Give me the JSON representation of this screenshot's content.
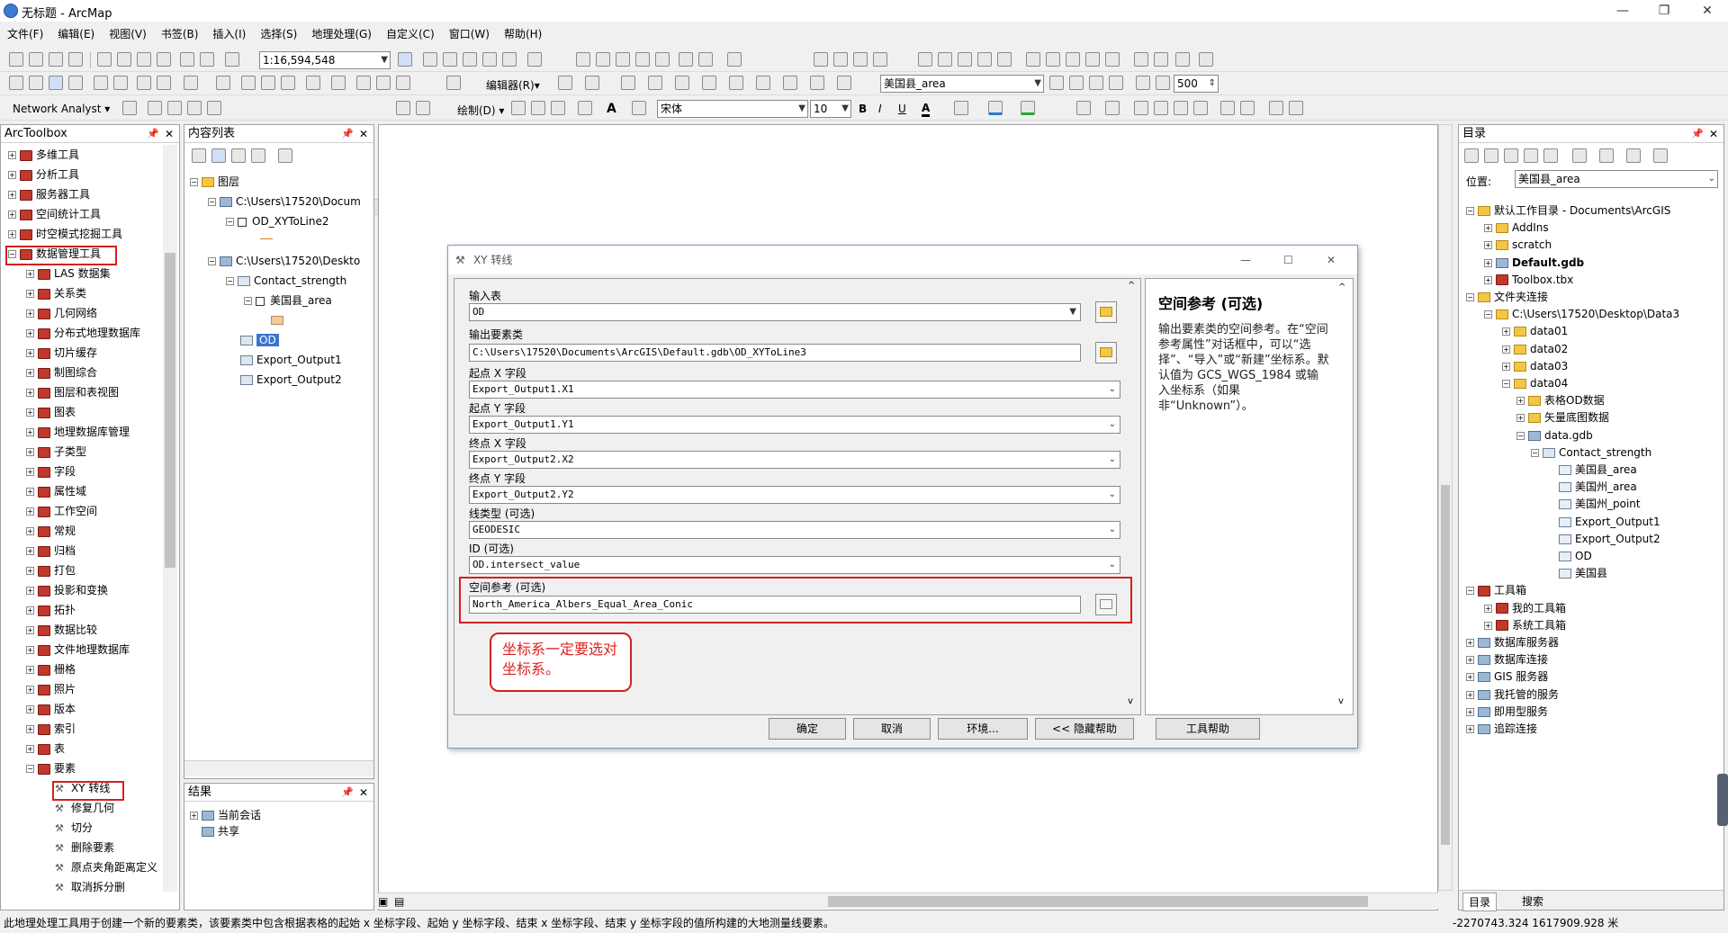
{
  "window": {
    "title": "无标题 - ArcMap",
    "minimize": "—",
    "maximize": "❐",
    "close": "✕"
  },
  "menu": [
    "文件(F)",
    "编辑(E)",
    "视图(V)",
    "书签(B)",
    "插入(I)",
    "选择(S)",
    "地理处理(G)",
    "自定义(C)",
    "窗口(W)",
    "帮助(H)"
  ],
  "toolbar": {
    "scale": "1:16,594,548",
    "editor": "编辑器(R)▾",
    "layer": "美国县_area",
    "sampling": "500",
    "network_analyst": "Network Analyst ▾",
    "draw": "绘制(D) ▾",
    "font": "宋体",
    "font_size": "10",
    "bold": "B",
    "italic": "I",
    "underline": "U",
    "font_color": "A"
  },
  "arctoolbox": {
    "title": "ArcToolbox",
    "top_items": [
      "多维工具",
      "分析工具",
      "服务器工具",
      "空间统计工具",
      "时空模式挖掘工具",
      "数据管理工具"
    ],
    "sub_items": [
      "LAS 数据集",
      "关系类",
      "几何网络",
      "分布式地理数据库",
      "切片缓存",
      "制图综合",
      "图层和表视图",
      "图表",
      "地理数据库管理",
      "子类型",
      "字段",
      "属性域",
      "工作空间",
      "常规",
      "归档",
      "打包",
      "投影和变换",
      "拓扑",
      "数据比较",
      "文件地理数据库",
      "栅格",
      "照片",
      "版本",
      "索引",
      "表",
      "要素"
    ],
    "tools": [
      "XY 转线",
      "修复几何",
      "切分",
      "删除要素",
      "原点夹角距离定义",
      "取消拆分删"
    ]
  },
  "toc": {
    "title": "内容列表",
    "root": "图层",
    "items": [
      {
        "label": "C:\\Users\\17520\\Docum"
      },
      {
        "label": "OD_XYToLine2"
      },
      {
        "label": "C:\\Users\\17520\\Deskto"
      },
      {
        "label": "Contact_strength"
      },
      {
        "label": "美国县_area"
      },
      {
        "label": "OD"
      },
      {
        "label": "Export_Output1"
      },
      {
        "label": "Export_Output2"
      }
    ]
  },
  "results": {
    "title": "结果",
    "items": [
      "当前会话",
      "共享"
    ]
  },
  "dialog": {
    "title": "XY 转线",
    "fields": [
      {
        "label": "输入表",
        "value": "OD"
      },
      {
        "label": "输出要素类",
        "value": "C:\\Users\\17520\\Documents\\ArcGIS\\Default.gdb\\OD_XYToLine3"
      },
      {
        "label": "起点 X 字段",
        "value": "Export_Output1.X1"
      },
      {
        "label": "起点 Y 字段",
        "value": "Export_Output1.Y1"
      },
      {
        "label": "终点 X 字段",
        "value": "Export_Output2.X2"
      },
      {
        "label": "终点 Y 字段",
        "value": "Export_Output2.Y2"
      },
      {
        "label": "线类型 (可选)",
        "value": "GEODESIC"
      },
      {
        "label": "ID (可选)",
        "value": "OD.intersect_value"
      },
      {
        "label": "空间参考 (可选)",
        "value": "North_America_Albers_Equal_Area_Conic"
      }
    ],
    "help_title": "空间参考 (可选)",
    "help_text": "输出要素类的空间参考。在“空间参考属性”对话框中，可以“选择”、“导入”或“新建”坐标系。默认值为 GCS_WGS_1984 或输入坐标系（如果非“Unknown”）。",
    "buttons": {
      "ok": "确定",
      "cancel": "取消",
      "env": "环境...",
      "hide_help": "<< 隐藏帮助",
      "tool_help": "工具帮助"
    },
    "callout": "坐标系一定要选对坐标系。"
  },
  "catalog": {
    "title": "目录",
    "location_label": "位置:",
    "location_value": "美国县_area",
    "tree": [
      "默认工作目录 - Documents\\ArcGIS",
      "AddIns",
      "scratch",
      "Default.gdb",
      "Toolbox.tbx",
      "文件夹连接",
      "C:\\Users\\17520\\Desktop\\Data3",
      "data01",
      "data02",
      "data03",
      "data04",
      "表格OD数据",
      "矢量底图数据",
      "data.gdb",
      "Contact_strength",
      "美国县_area",
      "美国州_area",
      "美国州_point",
      "Export_Output1",
      "Export_Output2",
      "OD",
      "美国县",
      "工具箱",
      "我的工具箱",
      "系统工具箱",
      "数据库服务器",
      "数据库连接",
      "GIS 服务器",
      "我托管的服务",
      "即用型服务",
      "追踪连接"
    ],
    "tabs": [
      "目录",
      "搜索"
    ]
  },
  "status": {
    "message": "此地理处理工具用于创建一个新的要素类，该要素类中包含根据表格的起始 x 坐标字段、起始 y 坐标字段、结束 x 坐标字段、结束 y 坐标字段的值所构建的大地测量线要素。",
    "coords": "-2270743.324  1617909.928 米"
  }
}
